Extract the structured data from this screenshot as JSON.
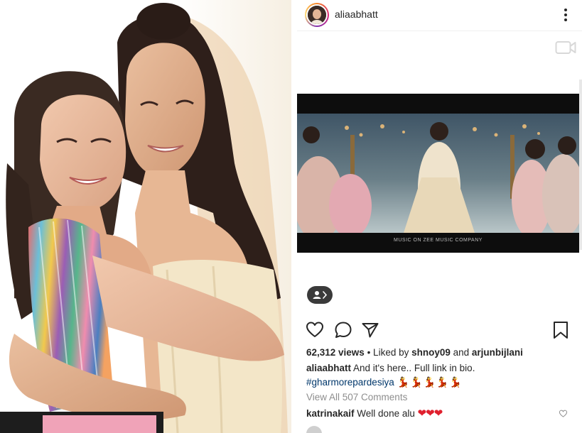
{
  "post": {
    "username": "aliaabhatt",
    "views_count": "62,312 views",
    "liked_by_prefix": " • Liked by ",
    "liked_user_1": "shnoy09",
    "liked_and": " and ",
    "liked_user_2": "arjunbijlani",
    "caption_user": "aliaabhatt",
    "caption_text": " And it's here.. Full link in bio.",
    "hashtag": "#gharmorepardesiya",
    "hashtag_emoji": "💃💃💃💃💃",
    "view_comments": "View All 507 Comments",
    "comment_user": "katrinakaif",
    "comment_text": " Well done alu ",
    "comment_emoji": "❤❤❤"
  },
  "video": {
    "credit": "MUSIC ON ZEE MUSIC COMPANY"
  },
  "icons": {
    "more": "more-vertical-icon",
    "video": "video-camera-icon",
    "tag": "user-tag-icon",
    "like": "heart-icon",
    "comment": "comment-bubble-icon",
    "share": "paper-plane-icon",
    "save": "bookmark-icon"
  },
  "colors": {
    "text": "#262626",
    "hashtag": "#00376b",
    "muted": "#8e8e8e",
    "heart": "#e0202e"
  }
}
